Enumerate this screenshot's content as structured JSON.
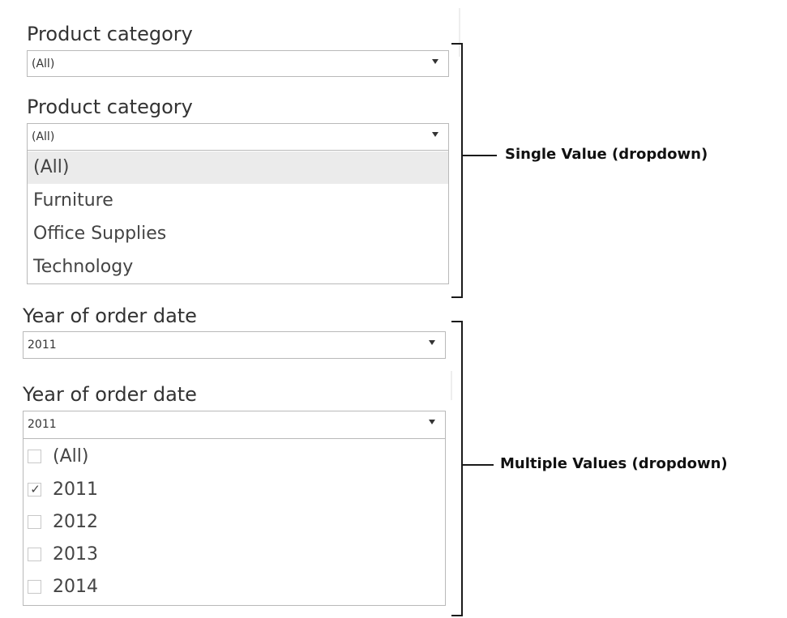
{
  "single": {
    "title1": "Product category",
    "value1": "(All)",
    "title2": "Product category",
    "value2": "(All)",
    "options": [
      "(All)",
      "Furniture",
      "Office Supplies",
      "Technology"
    ],
    "selected_index": 0
  },
  "multiple": {
    "title1": "Year of order date",
    "value1": "2011",
    "title2": "Year of order date",
    "value2": "2011",
    "options": [
      {
        "label": "(All)",
        "checked": false
      },
      {
        "label": "2011",
        "checked": true
      },
      {
        "label": "2012",
        "checked": false
      },
      {
        "label": "2013",
        "checked": false
      },
      {
        "label": "2014",
        "checked": false
      }
    ]
  },
  "annotations": {
    "single_label": "Single Value (dropdown)",
    "multiple_label": "Multiple Values (dropdown)"
  },
  "icons": {
    "dropdown_arrow": "triangle-down",
    "checkmark": "✓"
  }
}
